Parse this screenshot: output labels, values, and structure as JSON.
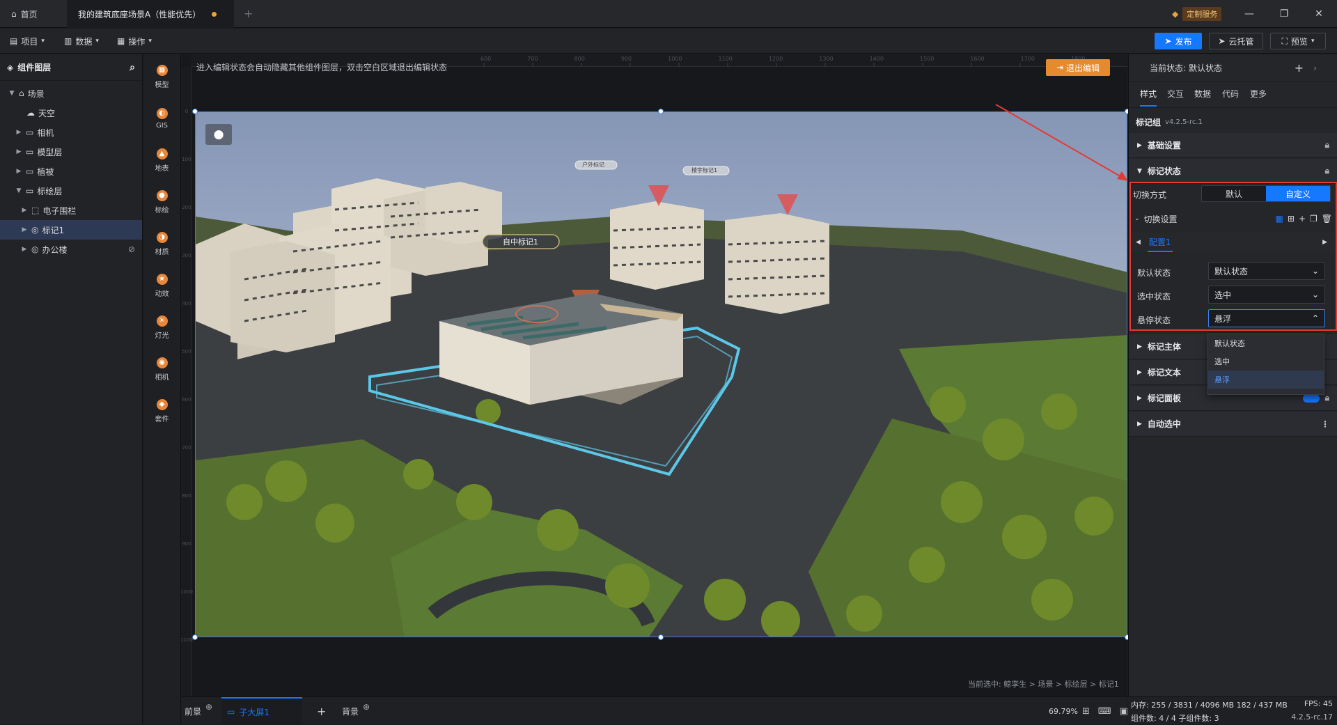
{
  "titlebar": {
    "home_tab": "首页",
    "project_tab": "我的建筑底座场景A（性能优先）",
    "new_tab_icon": "plus-icon",
    "service_label": "定制服务"
  },
  "toolbar": {
    "menu_project": "项目",
    "menu_data": "数据",
    "menu_operate": "操作",
    "publish": "发布",
    "cloud": "云托管",
    "preview": "预览"
  },
  "layers": {
    "title": "组件图层",
    "items": [
      {
        "label": "场景",
        "icon": "scene-icon"
      },
      {
        "label": "天空",
        "icon": "sky-icon"
      },
      {
        "label": "相机",
        "icon": "folder-icon"
      },
      {
        "label": "模型层",
        "icon": "folder-icon"
      },
      {
        "label": "植被",
        "icon": "folder-icon"
      },
      {
        "label": "标绘层",
        "icon": "folder-icon"
      },
      {
        "label": "电子围栏",
        "icon": "fence-icon"
      },
      {
        "label": "标记1",
        "icon": "marker-icon"
      },
      {
        "label": "办公楼",
        "icon": "marker-icon"
      }
    ]
  },
  "tools": [
    "模型",
    "GIS",
    "地表",
    "标绘",
    "材质",
    "动效",
    "灯光",
    "相机",
    "套件"
  ],
  "canvas": {
    "hint": "进入编辑状态会自动隐藏其他组件图层，双击空白区域退出编辑状态",
    "exit_edit": "退出编辑",
    "ruler_h": [
      "600",
      "700",
      "800",
      "900",
      "1000",
      "1100",
      "1200",
      "1300",
      "1400",
      "1500",
      "1600",
      "1700",
      "1800"
    ],
    "ruler_v": [
      "0",
      "100",
      "200",
      "300",
      "400",
      "500",
      "600",
      "700",
      "800",
      "900",
      "1000",
      "1100"
    ],
    "marker_label": "自中标记1",
    "tag1": "户外标记",
    "tag2": "楼宇标记1",
    "breadcrumbs": "当前选中: 鲸孪生 > 场景 > 标绘层 > 标记1"
  },
  "bottom": {
    "front": "前景",
    "screen": "子大屏1",
    "back": "背景",
    "zoom": "69.79%"
  },
  "panel": {
    "state_label": "当前状态:",
    "state_value": "默认状态",
    "tabs": [
      "样式",
      "交互",
      "数据",
      "代码",
      "更多"
    ],
    "component_name": "标记组",
    "version": "v4.2.5-rc.1",
    "sec_basic": "基础设置",
    "sec_marker_state": "标记状态",
    "switch_mode_label": "切换方式",
    "switch_default": "默认",
    "switch_custom": "自定义",
    "switch_settings": "切换设置",
    "config_tab": "配置1",
    "default_state_label": "默认状态",
    "default_state_value": "默认状态",
    "selected_state_label": "选中状态",
    "selected_state_value": "选中",
    "hover_state_label": "悬停状态",
    "hover_state_value": "悬浮",
    "dropdown_options": [
      "默认状态",
      "选中",
      "悬浮"
    ],
    "sec_body": "标记主体",
    "sec_text": "标记文本",
    "sec_panel": "标记面板",
    "sec_auto": "自动选中"
  },
  "status": {
    "memory": "内存:  255 / 3831 / 4096 MB  182 / 437 MB",
    "fps": "FPS:  45",
    "components": "组件数: 4 / 4   子组件数: 3",
    "version": "4.2.5-rc.17"
  },
  "colors": {
    "accent": "#1677ff",
    "exit": "#e68a2e",
    "highlight": "#e53935"
  }
}
